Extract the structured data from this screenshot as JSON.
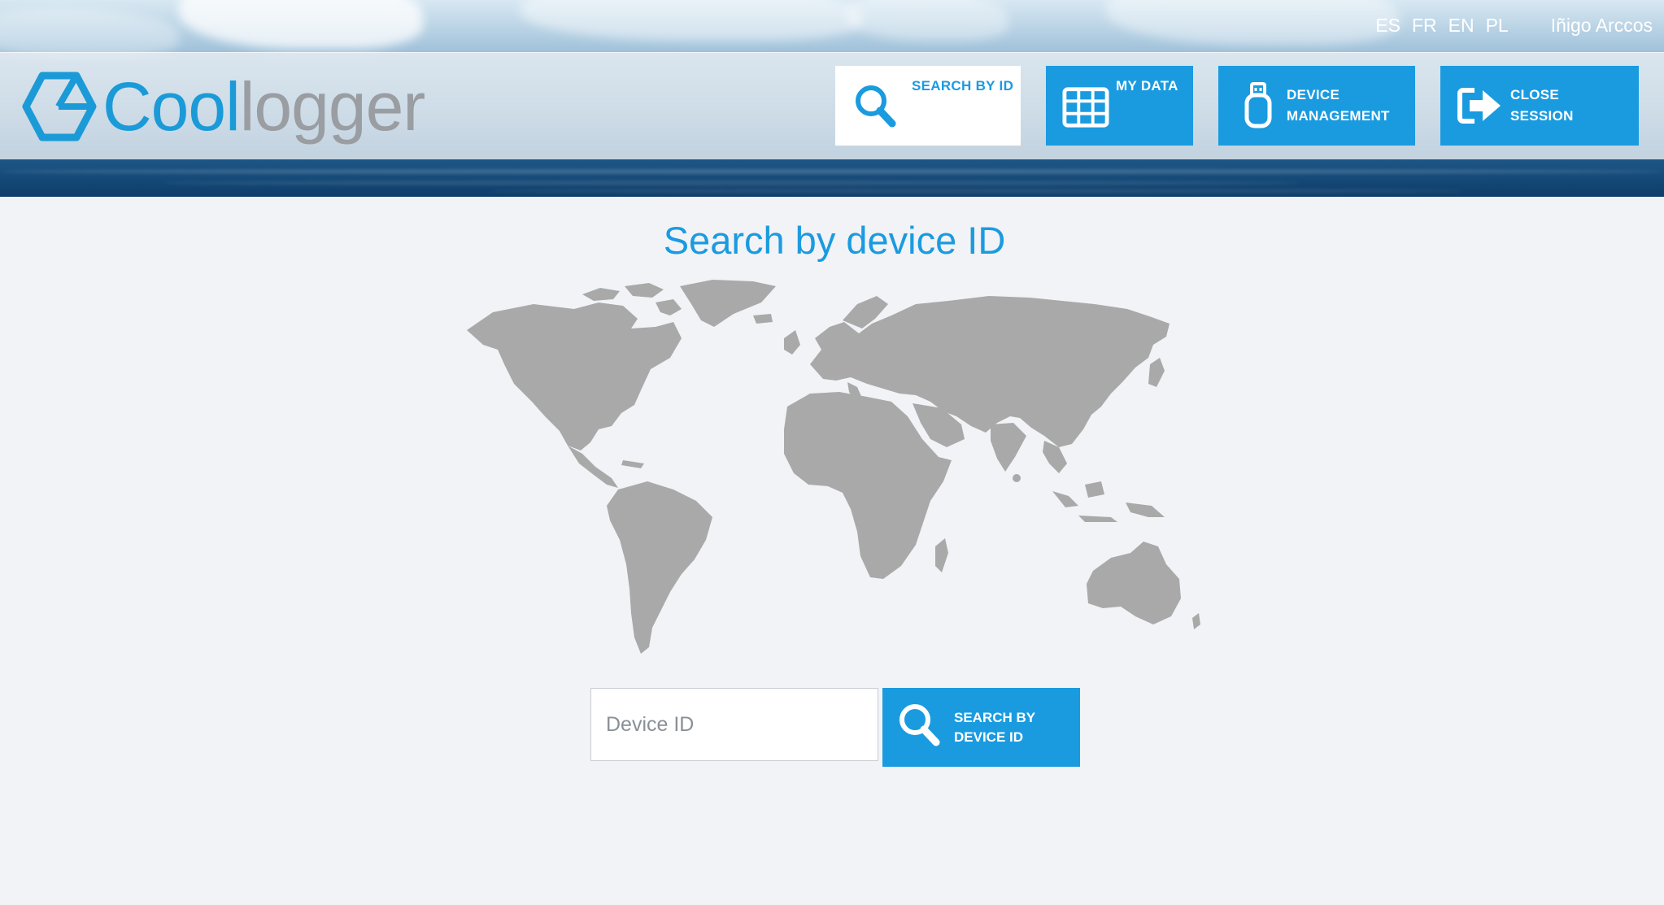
{
  "languages": [
    "ES",
    "FR",
    "EN",
    "PL"
  ],
  "user_name": "Iñigo Arccos",
  "logo": {
    "part1": "Cool",
    "part2": "logger"
  },
  "nav": [
    {
      "label_line1": "SEARCH BY ID",
      "label_line2": "",
      "icon": "search-icon",
      "active": true
    },
    {
      "label_line1": "MY DATA",
      "label_line2": "",
      "icon": "grid-icon",
      "active": false
    },
    {
      "label_line1": "DEVICE",
      "label_line2": "MANAGEMENT",
      "icon": "usb-drive-icon",
      "active": false
    },
    {
      "label_line1": "CLOSE",
      "label_line2": "SESSION",
      "icon": "logout-arrow-icon",
      "active": false
    }
  ],
  "main": {
    "title": "Search by device ID",
    "input_placeholder": "Device ID",
    "input_value": "",
    "search_button_line1": "SEARCH BY",
    "search_button_line2": "DEVICE ID"
  },
  "colors": {
    "accent": "#1a9be0",
    "map": "#a9a9a9",
    "background": "#f1f3f6"
  }
}
